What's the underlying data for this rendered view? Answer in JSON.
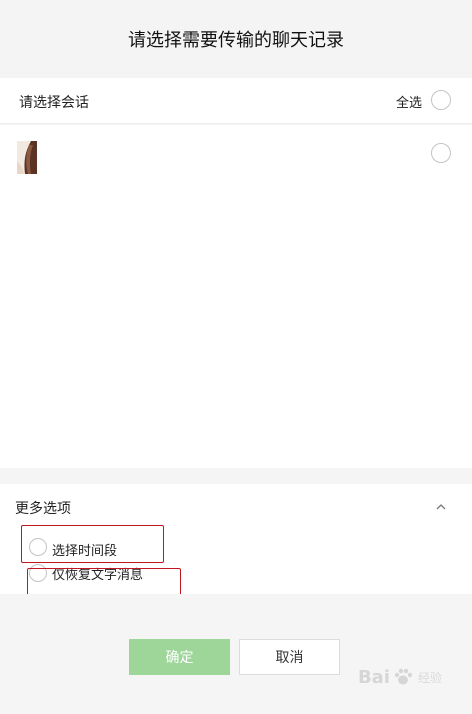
{
  "header": {
    "title": "请选择需要传输的聊天记录"
  },
  "select_bar": {
    "label": "请选择会话",
    "select_all_label": "全选"
  },
  "conversations": [
    {
      "avatar": "avatar-photo"
    }
  ],
  "more_options": {
    "title": "更多选项",
    "options": [
      {
        "label": "选择时间段"
      },
      {
        "label": "仅恢复文字消息"
      }
    ]
  },
  "footer": {
    "confirm_label": "确定",
    "cancel_label": "取消"
  },
  "watermark": {
    "text": "Bai",
    "sub": "经验"
  },
  "colors": {
    "confirm_button": "#9ed69a",
    "highlight_box": "#c0161f",
    "background": "#f5f5f5"
  }
}
